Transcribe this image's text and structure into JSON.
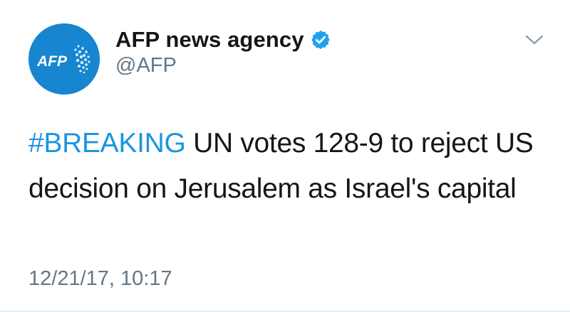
{
  "author": {
    "display_name": "AFP news agency",
    "handle": "@AFP",
    "verified": true,
    "avatar_logo_text": "AFP",
    "avatar_color": "#1785d0"
  },
  "tweet": {
    "hashtag": "#BREAKING",
    "body": " UN votes 128-9 to reject US decision on Jerusalem as Israel's capital",
    "timestamp": "12/21/17, 10:17"
  },
  "icons": {
    "verified": "verified-badge-icon",
    "menu": "chevron-down-icon"
  },
  "colors": {
    "link": "#1b95e0",
    "text": "#14171a",
    "secondary_text": "#657786",
    "verified_badge": "#1da1f2"
  }
}
